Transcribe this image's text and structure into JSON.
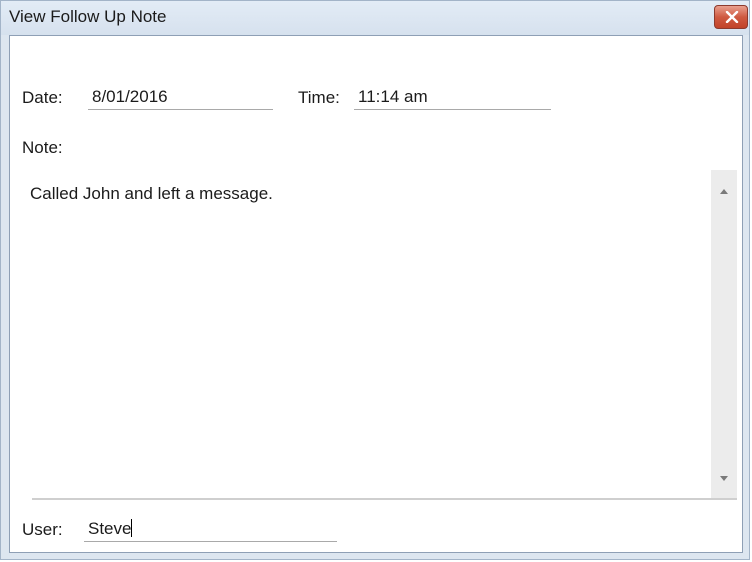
{
  "window": {
    "title": "View Follow Up Note"
  },
  "form": {
    "date_label": "Date:",
    "date_value": "8/01/2016",
    "time_label": "Time:",
    "time_value": "11:14 am",
    "note_label": "Note:",
    "note_text": "Called John and left a message.",
    "user_label": "User:",
    "user_value": "Steve"
  },
  "icons": {
    "close": "close-icon",
    "scroll_up": "chevron-up-icon",
    "scroll_down": "chevron-down-icon"
  },
  "colors": {
    "close_button": "#c24329",
    "title_bar": "#dde6f0"
  }
}
